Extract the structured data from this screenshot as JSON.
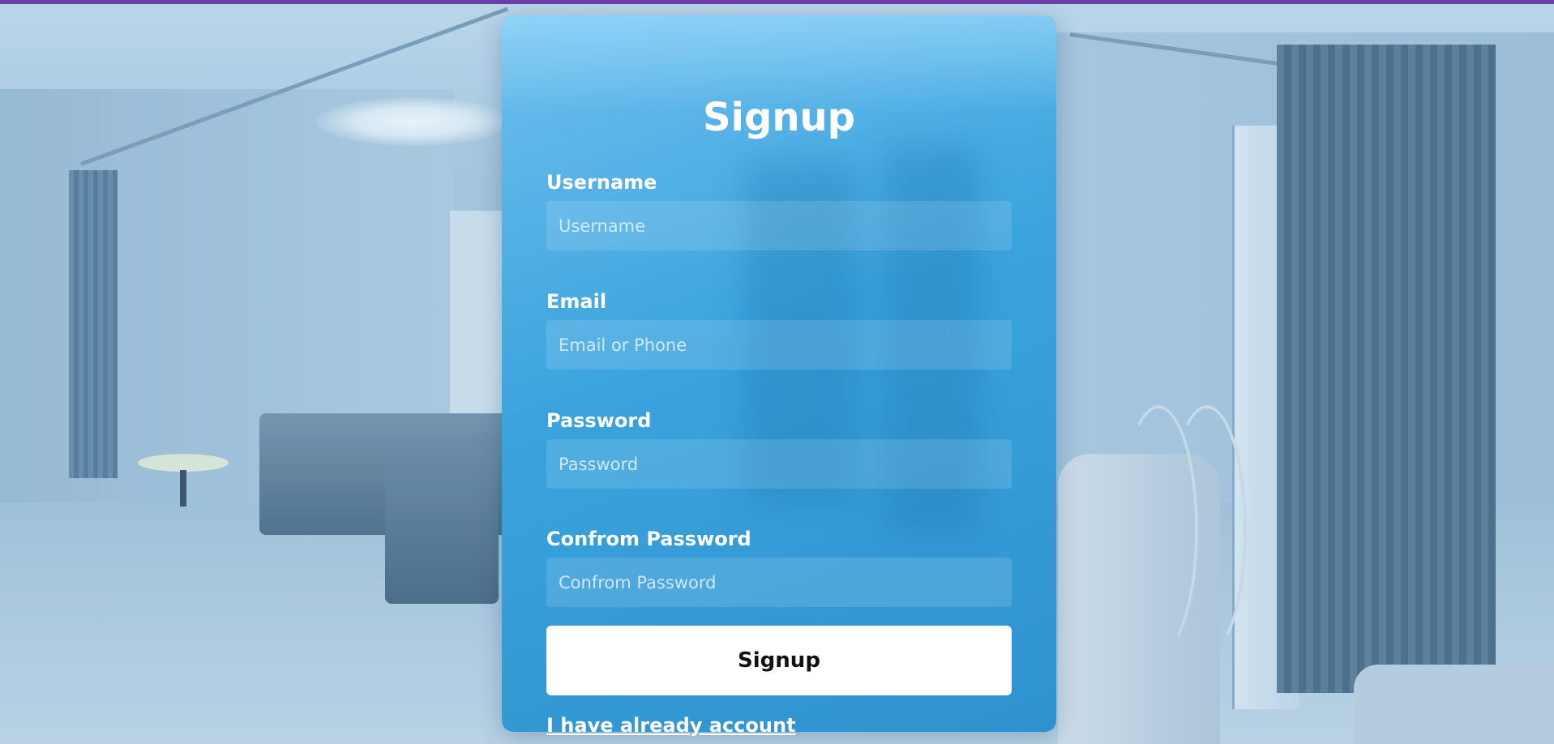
{
  "form": {
    "title": "Signup",
    "username": {
      "label": "Username",
      "placeholder": "Username"
    },
    "email": {
      "label": "Email",
      "placeholder": "Email or Phone"
    },
    "password": {
      "label": "Password",
      "placeholder": "Password"
    },
    "confirm_password": {
      "label": "Confrom Password",
      "placeholder": "Confrom Password"
    },
    "submit_label": "Signup",
    "login_link": "I have already account"
  },
  "colors": {
    "top_bar": "#6c3fa8",
    "card_background": "#3aa3dd",
    "button_background": "#ffffff",
    "text": "#ffffff"
  }
}
